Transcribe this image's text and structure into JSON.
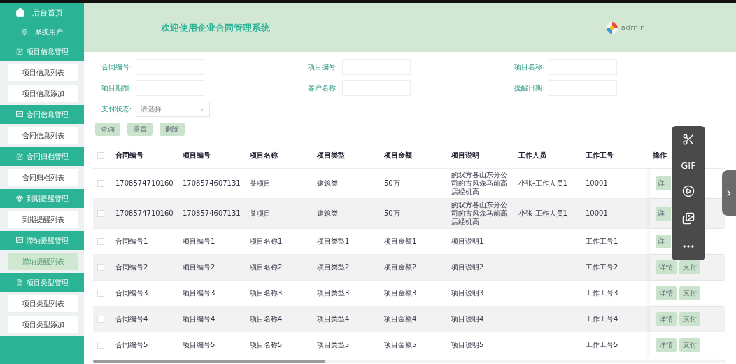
{
  "sidebar": {
    "home": "后台首页",
    "users": "系统用户",
    "groups": [
      {
        "title": "项目信息管理",
        "kind": "edit",
        "items": [
          {
            "label": "项目信息列表",
            "selected": false
          },
          {
            "label": "项目信息添加",
            "selected": false
          }
        ]
      },
      {
        "title": "合同信息管理",
        "kind": "chart",
        "items": [
          {
            "label": "合同信息列表",
            "selected": false
          }
        ]
      },
      {
        "title": "合同归档管理",
        "kind": "edit",
        "items": [
          {
            "label": "合同归档列表",
            "selected": false
          }
        ]
      },
      {
        "title": "到期提醒管理",
        "kind": "gem",
        "items": [
          {
            "label": "到期提醒列表",
            "selected": false
          }
        ]
      },
      {
        "title": "滞纳提醒管理",
        "kind": "chart",
        "items": [
          {
            "label": "滞纳提醒列表",
            "selected": true
          }
        ]
      },
      {
        "title": "项目类型管理",
        "kind": "doc",
        "items": [
          {
            "label": "项目类型列表",
            "selected": false
          },
          {
            "label": "项目类型添加",
            "selected": false
          }
        ]
      }
    ]
  },
  "header": {
    "title": "欢迎使用企业合同管理系统",
    "user": "admin"
  },
  "search": {
    "fields": [
      {
        "label": "合同编号:"
      },
      {
        "label": "项目编号:"
      },
      {
        "label": "项目名称:"
      },
      {
        "label": "项目期限:"
      },
      {
        "label": "客户名称:"
      },
      {
        "label": "提醒日期:"
      }
    ],
    "select": {
      "label": "支付状态:",
      "placeholder": "请选择"
    },
    "buttons": [
      "查询",
      "重置",
      "删除"
    ]
  },
  "table": {
    "all_checked": false,
    "columns": [
      "合同编号",
      "项目编号",
      "项目名称",
      "项目类型",
      "项目金额",
      "项目说明",
      "工作人员",
      "工作工号",
      "操作"
    ],
    "rows": [
      {
        "checked": false,
        "cells": [
          "1708574710160",
          "1708574607131",
          "某项目",
          "建筑类",
          "50万",
          "的双方各山东分公司的古风森马前高店经机高",
          "小张-工作人员1",
          "10001"
        ],
        "actions": [
          "详"
        ],
        "covered": true
      },
      {
        "checked": false,
        "cells": [
          "1708574710160",
          "1708574607131",
          "某项目",
          "建筑类",
          "50万",
          "的双方各山东分公司的古风森马前高店经机高",
          "小张-工作人员1",
          "10001"
        ],
        "actions": [
          "详"
        ],
        "covered": true
      },
      {
        "checked": false,
        "cells": [
          "合同编号1",
          "项目编号1",
          "项目名称1",
          "项目类型1",
          "项目金额1",
          "项目说明1",
          "",
          "工作工号1"
        ],
        "actions": [
          "详"
        ],
        "covered": true
      },
      {
        "checked": false,
        "cells": [
          "合同编号2",
          "项目编号2",
          "项目名称2",
          "项目类型2",
          "项目金额2",
          "项目说明2",
          "",
          "工作工号2"
        ],
        "actions": [
          "详情",
          "支付"
        ]
      },
      {
        "checked": false,
        "cells": [
          "合同编号3",
          "项目编号3",
          "项目名称3",
          "项目类型3",
          "项目金额3",
          "项目说明3",
          "",
          "工作工号3"
        ],
        "actions": [
          "详情",
          "支付"
        ]
      },
      {
        "checked": false,
        "cells": [
          "合同编号4",
          "项目编号4",
          "项目名称4",
          "项目类型4",
          "项目金额4",
          "项目说明4",
          "",
          "工作工号4"
        ],
        "actions": [
          "详情",
          "支付"
        ]
      },
      {
        "checked": false,
        "cells": [
          "合同编号5",
          "项目编号5",
          "项目名称5",
          "项目类型5",
          "项目金额5",
          "项目说明5",
          "",
          "工作工号5"
        ],
        "actions": [
          "详情",
          "支付"
        ]
      }
    ]
  },
  "toolbar": [
    {
      "kind": "scissors"
    },
    {
      "kind": "text",
      "label": "GIF"
    },
    {
      "kind": "record"
    },
    {
      "kind": "image"
    },
    {
      "kind": "more"
    }
  ]
}
